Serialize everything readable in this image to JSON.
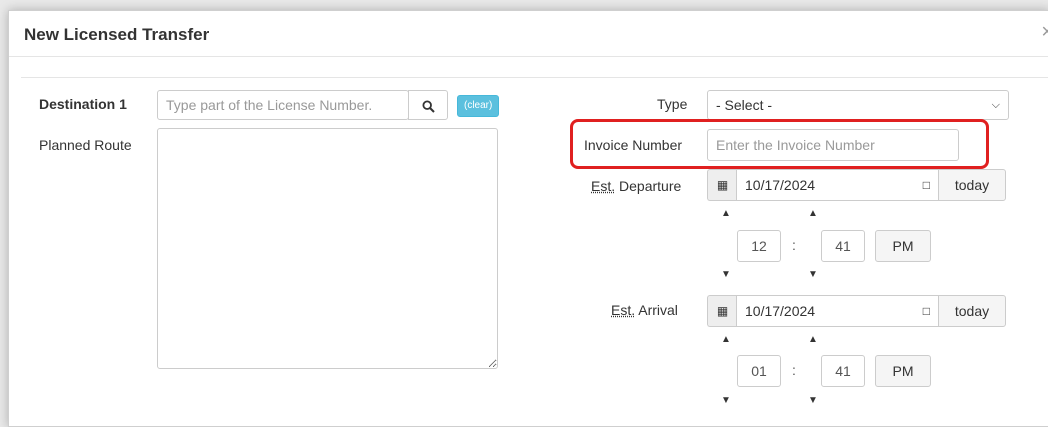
{
  "modal": {
    "title": "New Licensed Transfer",
    "close": "×"
  },
  "destination": {
    "label": "Destination 1",
    "placeholder": "Type part of the License Number.",
    "search_icon": "search-icon",
    "clear_label": "(clear)"
  },
  "planned_route": {
    "label": "Planned Route"
  },
  "type": {
    "label": "Type",
    "selected": "- Select -"
  },
  "invoice": {
    "label": "Invoice Number",
    "placeholder": "Enter the Invoice Number",
    "highlight_color": "#e02020"
  },
  "departure": {
    "label_abbr": "Est.",
    "label_rest": " Departure",
    "date": "10/17/2024",
    "today_label": "today",
    "hour": "12",
    "minute": "41",
    "colon": ":",
    "ampm": "PM"
  },
  "arrival": {
    "label_abbr": "Est.",
    "label_rest": " Arrival",
    "date": "10/17/2024",
    "today_label": "today",
    "hour": "01",
    "minute": "41",
    "colon": ":",
    "ampm": "PM"
  },
  "colors": {
    "clear_button": "#5bc0de",
    "highlight": "#e02020"
  }
}
